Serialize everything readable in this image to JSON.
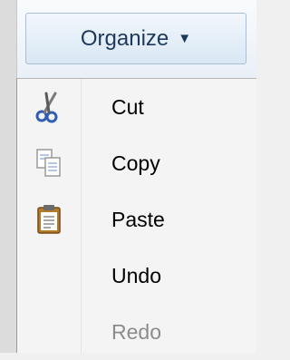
{
  "toolbar": {
    "organize_label": "Organize",
    "organize_arrow_icon": "triangle-down-icon"
  },
  "menu": {
    "items": [
      {
        "label": "Cut",
        "icon": "scissors-icon",
        "enabled": true
      },
      {
        "label": "Copy",
        "icon": "copy-icon",
        "enabled": true
      },
      {
        "label": "Paste",
        "icon": "clipboard-icon",
        "enabled": true
      },
      {
        "label": "Undo",
        "icon": "",
        "enabled": true
      },
      {
        "label": "Redo",
        "icon": "",
        "enabled": false
      }
    ]
  },
  "colors": {
    "button_text": "#1e395b",
    "disabled_text": "#8c8c8c",
    "scissors_blue": "#3a6fc4"
  }
}
